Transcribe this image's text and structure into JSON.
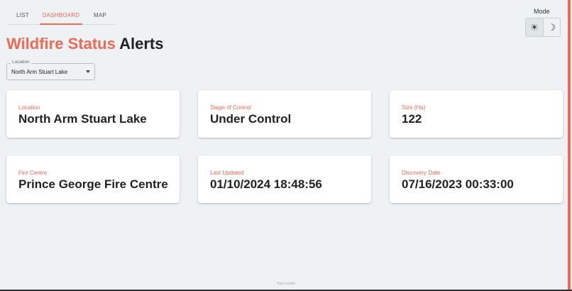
{
  "tabs": [
    {
      "label": "LIST"
    },
    {
      "label": "DASHBOARD"
    },
    {
      "label": "MAP"
    }
  ],
  "mode": {
    "label": "Mode",
    "light_icon": "sun-icon",
    "dark_icon": "moon-icon",
    "selected": "light"
  },
  "title": {
    "accent": "Wildfire Status",
    "rest": "Alerts"
  },
  "location_select": {
    "legend": "Location",
    "value": "North Arm Stuart Lake"
  },
  "cards": [
    {
      "label": "Location",
      "value": "North Arm Stuart Lake"
    },
    {
      "label": "Stage of Control",
      "value": "Under Control"
    },
    {
      "label": "Size (Ha)",
      "value": "122"
    },
    {
      "label": "Fire Centre",
      "value": "Prince George Fire Centre"
    },
    {
      "label": "Last Updated",
      "value": "01/10/2024 18:48:56"
    },
    {
      "label": "Discovery Date",
      "value": "07/16/2023 00:33:00"
    }
  ],
  "footer": "Talyn Inside",
  "colors": {
    "accent": "#ef6a55",
    "background": "#eef2f4",
    "card": "#ffffff"
  }
}
